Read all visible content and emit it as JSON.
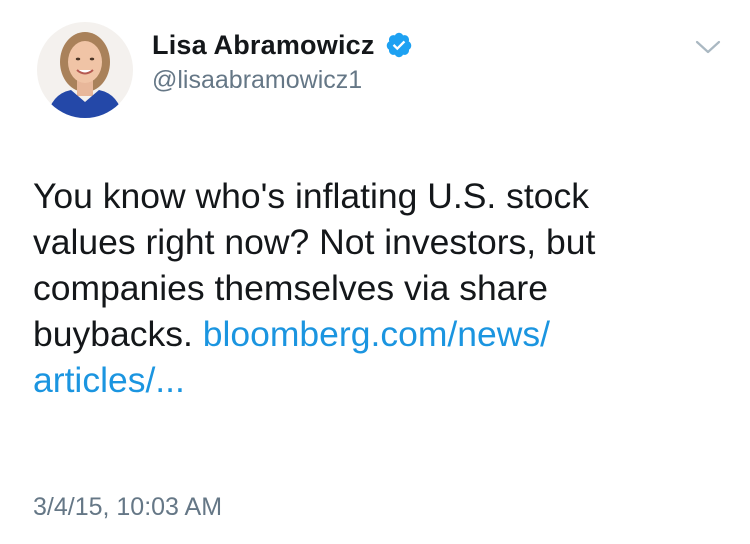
{
  "author": {
    "display_name": "Lisa Abramowicz",
    "handle": "@lisaabramowicz1",
    "verified": true
  },
  "tweet": {
    "text_lines": [
      "You know who's inflating U.S. stock",
      "values right now? Not investors, but",
      "companies themselves via share",
      "buybacks."
    ],
    "link_line_1": "bloomberg.com/news/",
    "link_line_2": "articles/...",
    "timestamp": "3/4/15, 10:03 AM"
  },
  "icons": {
    "verified": "verified-badge-icon",
    "menu": "chevron-down-icon"
  },
  "colors": {
    "link": "#1b95e0",
    "secondary_text": "#657786",
    "primary_text": "#14171a",
    "verified_badge": "#1da1f2"
  }
}
